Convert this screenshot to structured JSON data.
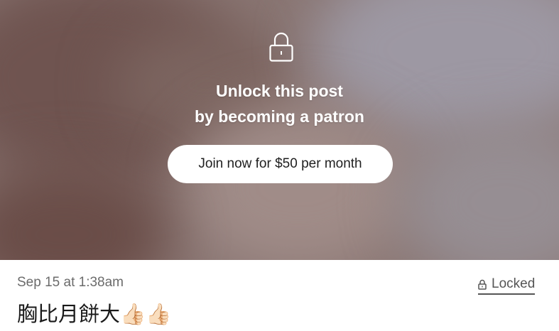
{
  "locked_overlay": {
    "icon": "lock-icon",
    "title_line1": "Unlock this post",
    "title_line2": "by becoming a patron",
    "join_button_label": "Join now for $50 per month"
  },
  "post": {
    "timestamp": "Sep 15 at 1:38am",
    "locked_label": "Locked",
    "locked_icon": "small-lock-icon",
    "title": "胸比月餅大👍🏻👍🏻"
  },
  "colors": {
    "button_bg": "#ffffff",
    "button_text": "#1f1f1f",
    "overlay_text": "#ffffff",
    "meta_text": "#6b6b6b"
  }
}
